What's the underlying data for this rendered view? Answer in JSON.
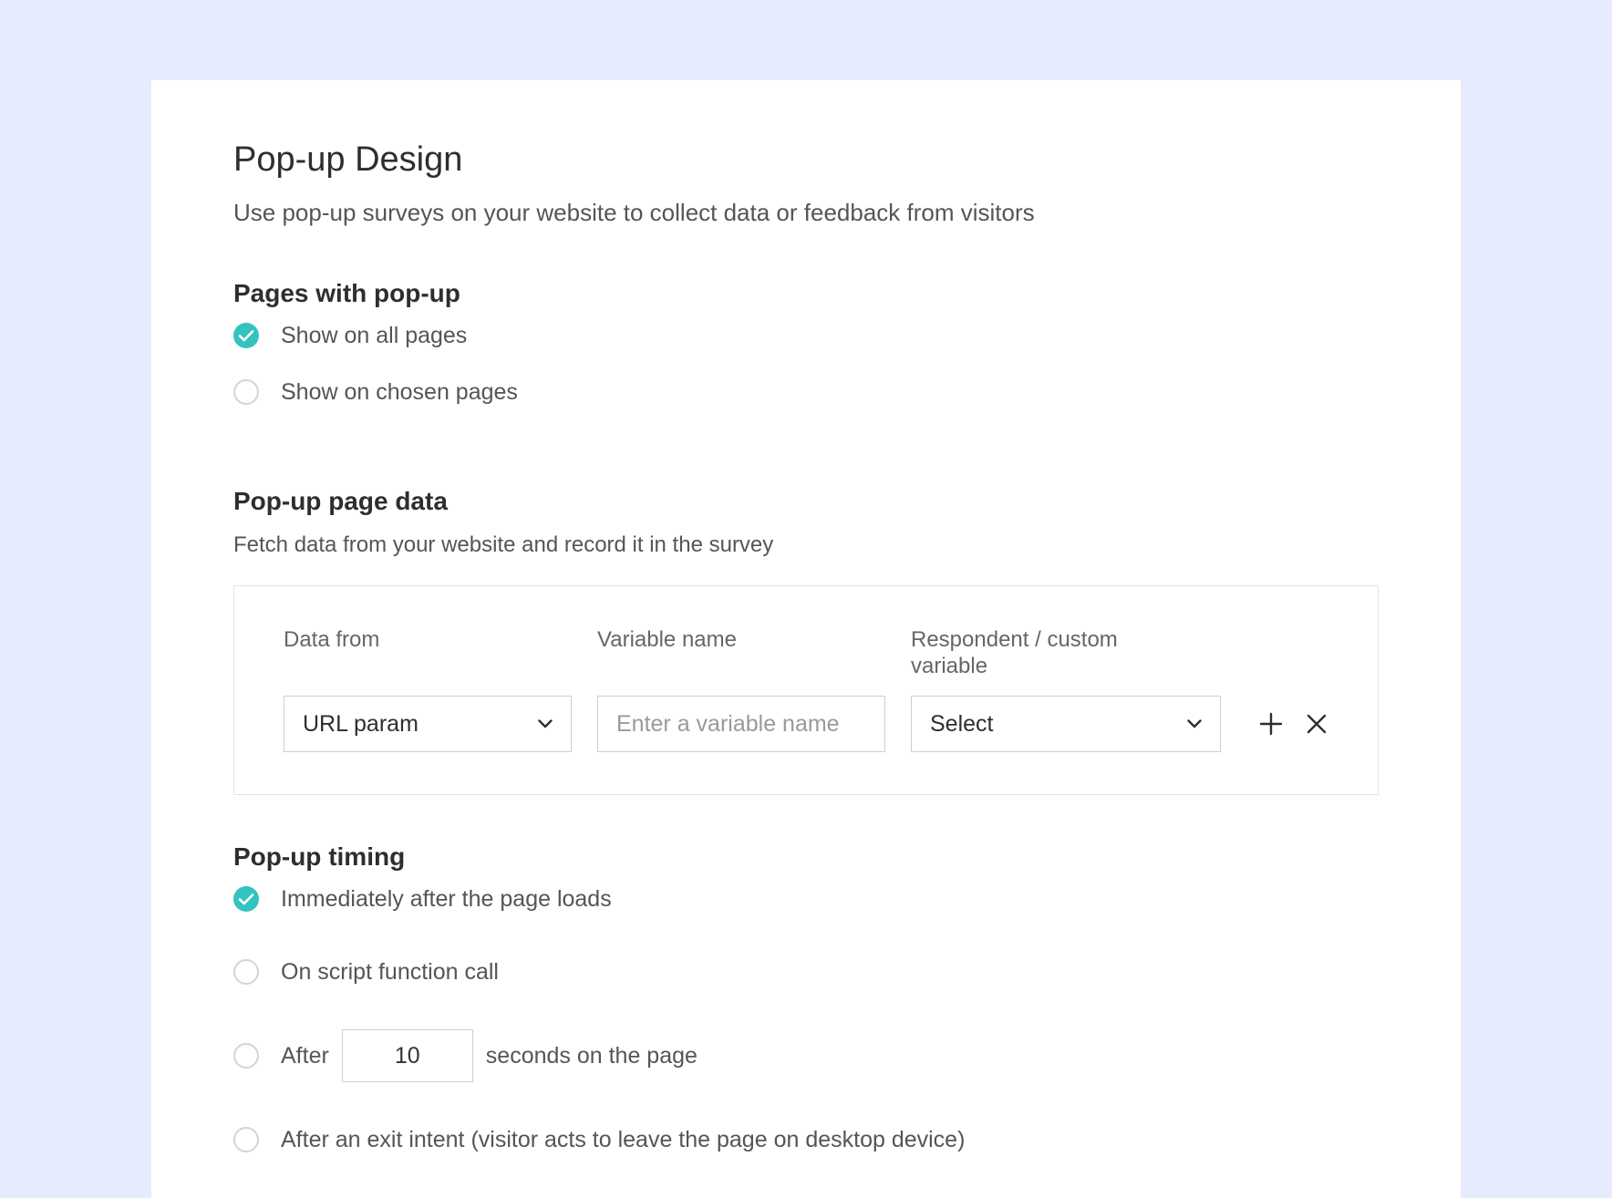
{
  "header": {
    "title": "Pop-up Design",
    "subtitle": "Use pop-up surveys on your website to collect data or feedback from visitors"
  },
  "pages_section": {
    "title": "Pages with pop-up",
    "options": [
      {
        "label": "Show on all pages",
        "selected": true
      },
      {
        "label": "Show on chosen pages",
        "selected": false
      }
    ]
  },
  "page_data_section": {
    "title": "Pop-up page data",
    "description": "Fetch data from your website and record it in the survey",
    "columns": {
      "data_from": "Data from",
      "variable_name": "Variable name",
      "respondent_var": "Respondent / custom variable"
    },
    "row": {
      "data_from_value": "URL param",
      "variable_placeholder": "Enter a variable name",
      "respondent_value": "Select"
    },
    "icons": {
      "add": "plus-icon",
      "remove": "close-icon",
      "dropdown": "chevron-down-icon"
    }
  },
  "timing_section": {
    "title": "Pop-up timing",
    "options": [
      {
        "label": "Immediately after the page loads",
        "selected": true
      },
      {
        "label": "On script function call",
        "selected": false
      },
      {
        "label_before": "After",
        "seconds_value": "10",
        "label_after": "seconds on the page",
        "selected": false
      },
      {
        "label": "After an exit intent (visitor acts to leave the page on desktop device)",
        "selected": false
      }
    ]
  },
  "colors": {
    "background": "#e6ecfd",
    "accent": "#33c3c0",
    "card": "#ffffff"
  }
}
